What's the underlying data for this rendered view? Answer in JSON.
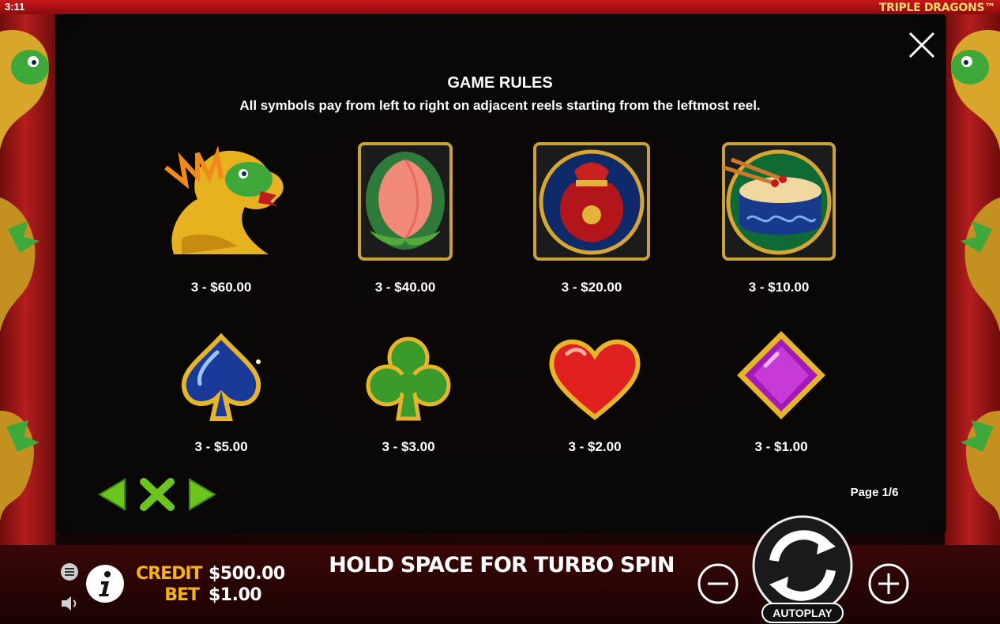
{
  "status_bar": {
    "clock": "3:11",
    "game_title": "TRIPLE DRAGONS™"
  },
  "rules": {
    "title": "GAME RULES",
    "subtitle": "All symbols pay from left to right on adjacent reels starting from the leftmost reel.",
    "symbols": [
      {
        "icon": "dragon-icon",
        "payout": "3 - $60.00"
      },
      {
        "icon": "peach-icon",
        "payout": "3 - $40.00"
      },
      {
        "icon": "money-bag-icon",
        "payout": "3 - $20.00"
      },
      {
        "icon": "drum-icon",
        "payout": "3 - $10.00"
      },
      {
        "icon": "spade-icon",
        "payout": "3 - $5.00"
      },
      {
        "icon": "club-icon",
        "payout": "3 - $3.00"
      },
      {
        "icon": "heart-icon",
        "payout": "3 - $2.00"
      },
      {
        "icon": "diamond-icon",
        "payout": "3 - $1.00"
      }
    ],
    "page_label": "Page 1/6"
  },
  "bottom": {
    "credit_label": "CREDIT",
    "credit_value": "$500.00",
    "bet_label": "BET",
    "bet_value": "$1.00",
    "turbo_hint": "HOLD SPACE FOR TURBO SPIN",
    "autoplay_label": "AUTOPLAY"
  },
  "colors": {
    "accent_gold": "#f6b21a",
    "nav_green": "#6cc41e",
    "frame_red": "#b51d1d"
  }
}
